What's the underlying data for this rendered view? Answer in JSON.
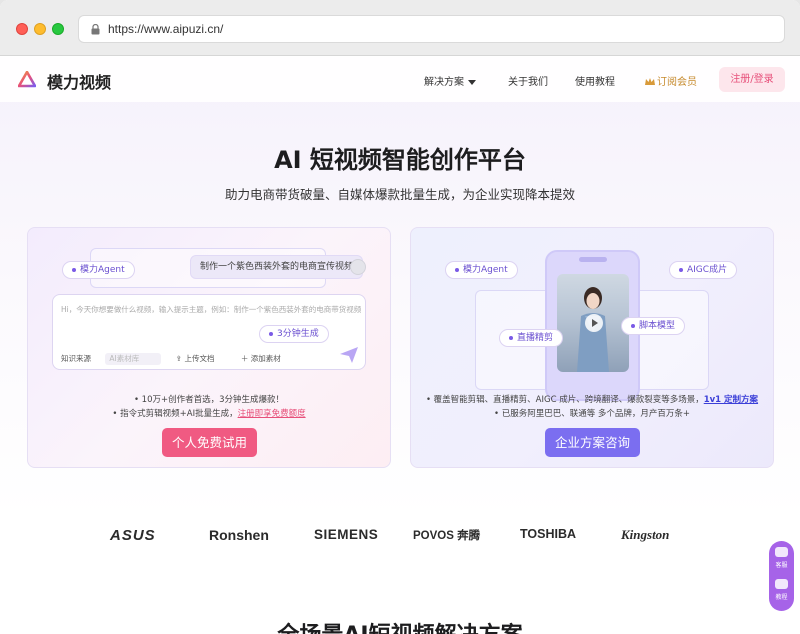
{
  "browser": {
    "url": "https://www.aipuzi.cn/"
  },
  "nav": {
    "brand": "模力视频",
    "items": [
      "解决方案",
      "关于我们",
      "使用教程",
      "订阅会员"
    ],
    "signup": "注册/登录"
  },
  "hero": {
    "title": "AI 短视频智能创作平台",
    "subtitle": "助力电商带货破量、自媒体爆款批量生成，为企业实现降本提效"
  },
  "left_card": {
    "pill_agent": "模力Agent",
    "prompt_bubble": "制作一个紫色西装外套的电商宣传视频",
    "input_placeholder": "Hi，今天你想要做什么视频，输入提示主题，例如：制作一个紫色西装外套的电商带货视频",
    "pill_3min": "3分钟生成",
    "tools": [
      "知识来源",
      "AI素材库",
      "上传文档",
      "添加素材"
    ],
    "bullet1": "10万+创作者首选，3分钟生成爆款！",
    "bullet2_prefix": "指令式剪辑视频+AI批量生成，",
    "bullet2_link": "注册即享免费额度",
    "cta": "个人免费试用"
  },
  "right_card": {
    "pills": [
      "模力Agent",
      "AIGC成片",
      "直播精剪",
      "脚本模型"
    ],
    "bullet1_prefix": "覆盖智能剪辑、直播精剪、AIGC 成片、跨境翻译、爆款裂变等多场景，",
    "bullet1_link": "1v1 定制方案",
    "bullet2": "已服务阿里巴巴、联通等 多个品牌，月产百万条+",
    "cta": "企业方案咨询"
  },
  "brands": [
    "ASUS",
    "Ronshen",
    "SIEMENS",
    "POVOS 奔腾",
    "TOSHIBA",
    "Kingston"
  ],
  "float": {
    "top": "客服",
    "bottom": "教程"
  },
  "bottom_title": "全场景AI短视频解决方案",
  "colors": {
    "accent_pink": "#f05a82",
    "accent_purple": "#7b6ef0",
    "vip_gold": "#c68a2c"
  }
}
